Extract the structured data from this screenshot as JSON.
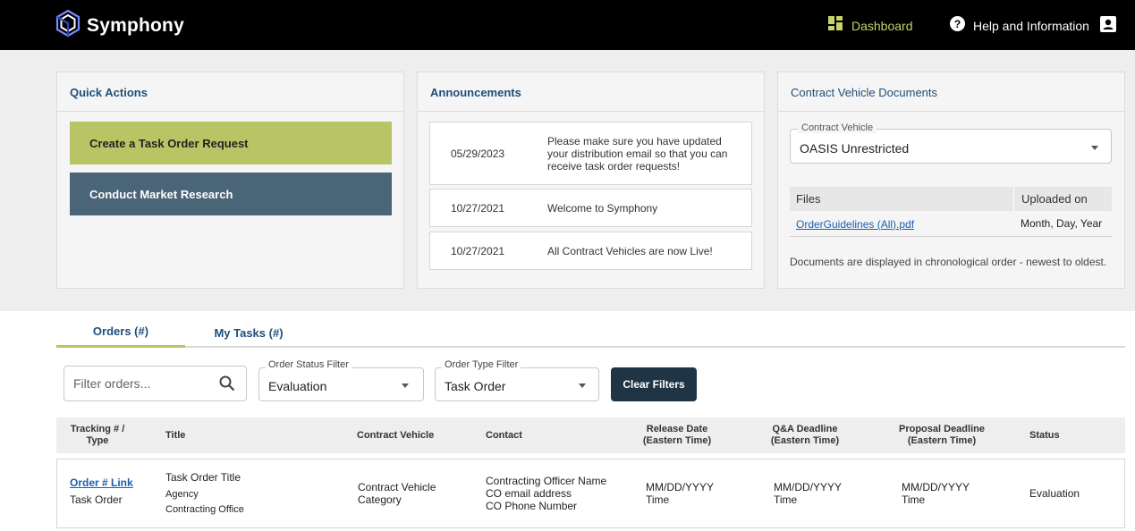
{
  "header": {
    "brand": "Symphony",
    "nav": {
      "dashboard": "Dashboard",
      "help": "Help and Information"
    },
    "colors": {
      "bar": "#000000",
      "accent": "#c9d36a"
    }
  },
  "quick_actions": {
    "title": "Quick Actions",
    "create": "Create a Task Order Request",
    "research": "Conduct Market Research"
  },
  "announcements": {
    "title": "Announcements",
    "items": [
      {
        "date": "05/29/2023",
        "text": "Please make sure you have updated your distribution email so that you can receive task order requests!"
      },
      {
        "date": "10/27/2021",
        "text": "Welcome to Symphony"
      },
      {
        "date": "10/27/2021",
        "text": "All Contract Vehicles are now Live!"
      }
    ]
  },
  "documents": {
    "title": "Contract Vehicle Documents",
    "vehicle_label": "Contract Vehicle",
    "vehicle_value": "OASIS Unrestricted",
    "col_files": "Files",
    "col_uploaded": "Uploaded on",
    "file_name": "OrderGuidelines (All).pdf",
    "file_date": "Month, Day, Year",
    "note": "Documents are displayed in chronological order - newest to oldest."
  },
  "tabs": {
    "orders": "Orders (#)",
    "tasks": "My Tasks (#)"
  },
  "filters": {
    "search_placeholder": "Filter orders...",
    "status_label": "Order Status Filter",
    "status_value": "Evaluation",
    "type_label": "Order Type Filter",
    "type_value": "Task Order",
    "clear": "Clear Filters"
  },
  "table": {
    "headers": {
      "tracking": "Tracking # / Type",
      "title": "Title",
      "vehicle": "Contract Vehicle",
      "contact": "Contact",
      "release": "Release Date (Eastern Time)",
      "qa": "Q&A Deadline (Eastern Time)",
      "proposal": "Proposal Deadline (Eastern Time)",
      "status": "Status"
    },
    "row": {
      "order_link": "Order # Link",
      "type": "Task Order",
      "title": "Task Order Title",
      "agency": "Agency",
      "office": "Contracting Office",
      "vehicle": "Contract Vehicle",
      "category": "Category",
      "contact_name": "Contracting Officer Name",
      "contact_email": "CO email address",
      "contact_phone": "CO Phone Number",
      "release_date": "MM/DD/YYYY",
      "release_time": "Time",
      "qa_date": "MM/DD/YYYY",
      "qa_time": "Time",
      "proposal_date": "MM/DD/YYYY",
      "proposal_time": "Time",
      "status": "Evaluation"
    }
  }
}
